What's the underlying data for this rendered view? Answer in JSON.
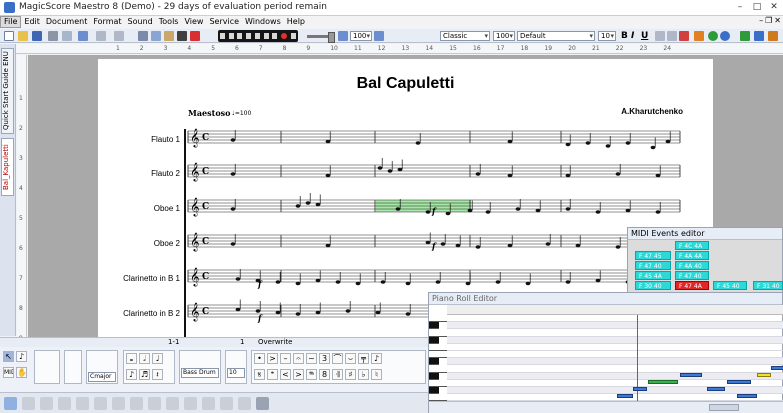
{
  "window": {
    "title": "MagicScore Maestro 8 (Demo) - 29 days of evaluation period remain"
  },
  "menu": [
    "File",
    "Edit",
    "Document",
    "Format",
    "Sound",
    "Tools",
    "View",
    "Service",
    "Windows",
    "Help"
  ],
  "toolbar": {
    "zoom": "100",
    "style": "Classic",
    "size": "100",
    "font": "Default",
    "font_size": "10",
    "bold": "B",
    "italic": "I",
    "underline": "U"
  },
  "side_tabs": [
    "Quick Start Guide ENU",
    "Bal_Kapuletti"
  ],
  "ruler_marks": [
    "1",
    "2",
    "3",
    "4",
    "5",
    "6",
    "7",
    "8",
    "9",
    "10",
    "11",
    "12",
    "13",
    "14",
    "15",
    "16",
    "17",
    "18",
    "19",
    "20",
    "21",
    "22",
    "23",
    "24"
  ],
  "score": {
    "title": "Bal Capuletti",
    "tempo": "Maestoso",
    "tempo_mark": "♩=100",
    "composer": "A.Kharutchenko",
    "instruments": [
      "Flauto 1",
      "Flauto 2",
      "Oboe 1",
      "Oboe 2",
      "Clarinetto in B 1",
      "Clarinetto in B 2"
    ]
  },
  "status": {
    "position": "1-1",
    "page": "1",
    "mode": "Overwrite"
  },
  "palette": {
    "instrument": "Bass Drum 2",
    "value": "10",
    "clef_label": "Cmajor"
  },
  "midi_editor": {
    "title": "MIDI Events editor",
    "events": [
      "F 4C 4A",
      "F 47 45",
      "F 4A 4A",
      "F 47 40",
      "F 4A 40",
      "F 45 4A",
      "F 47 40",
      "F 48 40",
      "F 47 4A",
      "F 45 40",
      "F 31 40",
      "F 30 40"
    ]
  },
  "piano_roll": {
    "title": "Piano Roll Editor",
    "key_labels": [
      "C",
      "C",
      "C",
      "C",
      "C",
      "C",
      "C",
      "C",
      "C",
      "C",
      "C"
    ]
  },
  "colors": {
    "selection": "#90e090",
    "midi_cell": "#2fd7d7",
    "midi_selected": "#e02828",
    "note": "#3c7ad8"
  }
}
